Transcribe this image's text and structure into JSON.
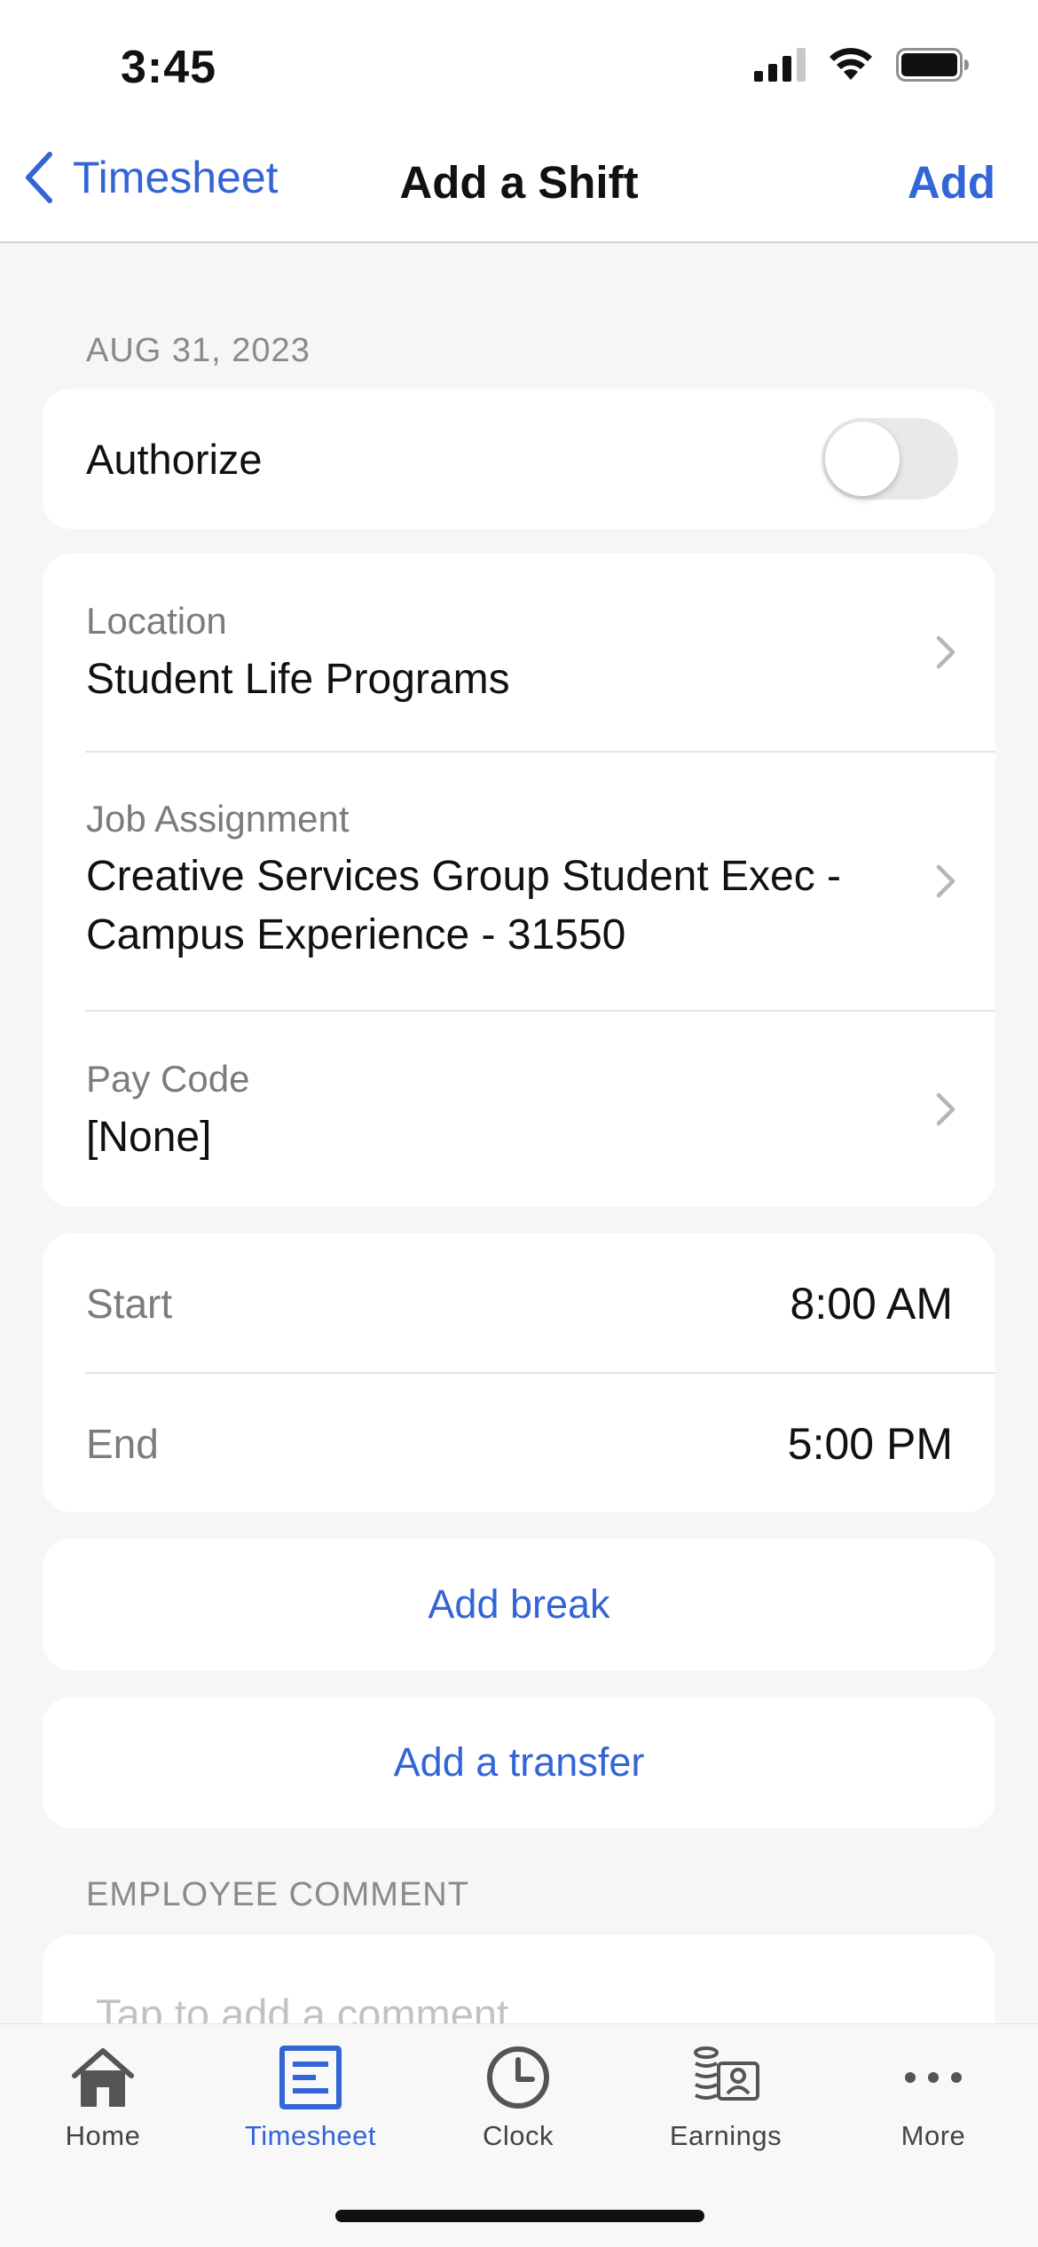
{
  "status_bar": {
    "time": "3:45"
  },
  "nav": {
    "back_label": "Timesheet",
    "title": "Add a Shift",
    "action_label": "Add"
  },
  "date_header": "AUG 31, 2023",
  "authorize": {
    "label": "Authorize",
    "enabled": false
  },
  "details": {
    "location": {
      "label": "Location",
      "value": "Student Life Programs"
    },
    "job": {
      "label": "Job Assignment",
      "value_line1": "Creative Services Group Student Exec -",
      "value_line2": "Campus Experience - 31550"
    },
    "pay_code": {
      "label": "Pay Code",
      "value": "[None]"
    }
  },
  "times": {
    "start": {
      "label": "Start",
      "value": "8:00 AM"
    },
    "end": {
      "label": "End",
      "value": "5:00 PM"
    }
  },
  "add_break_label": "Add break",
  "add_transfer_label": "Add a transfer",
  "comment": {
    "section_label": "EMPLOYEE COMMENT",
    "placeholder": "Tap to add a comment"
  },
  "tabs": [
    {
      "label": "Home",
      "icon": "home-icon",
      "active": false
    },
    {
      "label": "Timesheet",
      "icon": "timesheet-icon",
      "active": true
    },
    {
      "label": "Clock",
      "icon": "clock-icon",
      "active": false
    },
    {
      "label": "Earnings",
      "icon": "earnings-icon",
      "active": false
    },
    {
      "label": "More",
      "icon": "more-icon",
      "active": false
    }
  ],
  "colors": {
    "accent": "#3465d6",
    "background": "#f6f6f7",
    "card": "#ffffff"
  }
}
